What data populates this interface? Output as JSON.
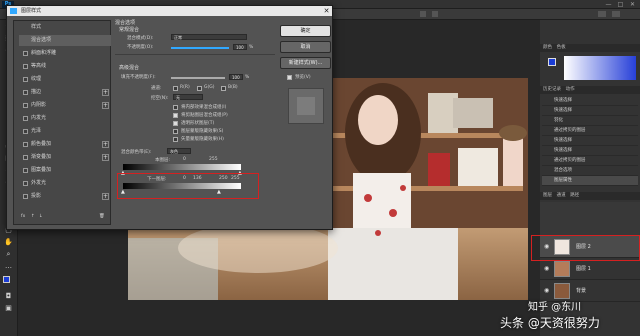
{
  "app": {
    "logo": "Ps",
    "win_controls": [
      "—",
      "□",
      "✕"
    ]
  },
  "colors": {
    "accent": "#31a8ff",
    "highlight_red": "#d52121",
    "dialog_bg": "#535353"
  },
  "dialog": {
    "title": "图层样式",
    "sidebar": [
      {
        "label": "样式",
        "checkbox": false,
        "plus": false
      },
      {
        "label": "混合选项",
        "checkbox": false,
        "plus": false
      },
      {
        "label": "斜面和浮雕",
        "checkbox": true,
        "plus": false
      },
      {
        "label": "等高线",
        "checkbox": true,
        "plus": false
      },
      {
        "label": "纹理",
        "checkbox": true,
        "plus": false
      },
      {
        "label": "描边",
        "checkbox": true,
        "plus": true
      },
      {
        "label": "内阴影",
        "checkbox": true,
        "plus": true
      },
      {
        "label": "内发光",
        "checkbox": true,
        "plus": false
      },
      {
        "label": "光泽",
        "checkbox": true,
        "plus": false
      },
      {
        "label": "颜色叠加",
        "checkbox": true,
        "plus": true
      },
      {
        "label": "渐变叠加",
        "checkbox": true,
        "plus": true
      },
      {
        "label": "图案叠加",
        "checkbox": true,
        "plus": false
      },
      {
        "label": "外发光",
        "checkbox": true,
        "plus": false
      },
      {
        "label": "投影",
        "checkbox": true,
        "plus": true
      }
    ],
    "sidebar_footer": [
      "fx",
      "↑",
      "↓",
      "🗑"
    ],
    "blend_options": {
      "section_title": "混合选项",
      "general_title": "常规混合",
      "blend_mode_label": "混合模式(D):",
      "blend_mode_value": "正常",
      "opacity_label": "不透明度(O):",
      "opacity_value": "100",
      "opacity_unit": "%",
      "opacity_fraction": 1.0,
      "advanced_title": "高级混合",
      "fill_opacity_label": "填充不透明度(F):",
      "fill_opacity_value": "100",
      "fill_opacity_unit": "%",
      "fill_opacity_fraction": 1.0,
      "channels_label": "通道:",
      "channels": [
        "R(R)",
        "G(G)",
        "B(B)"
      ],
      "knockout_label": "挖空(N):",
      "knockout_value": "无",
      "options": [
        "将内部效果混合成组(I)",
        "将剪贴图层混合成组(P)",
        "透明形状图层(T)",
        "图层蒙版隐藏效果(S)",
        "矢量蒙版隐藏效果(H)"
      ],
      "options_checked": [
        false,
        true,
        true,
        false,
        false
      ],
      "blend_if_label": "混合颜色带(E):",
      "blend_if_value": "灰色",
      "this_layer_label": "本图层:",
      "this_layer_min": "0",
      "this_layer_max": "255",
      "underlying_label": "下一图层:",
      "underlying_min": "0",
      "underlying_mid1": "136",
      "underlying_mid2": "250",
      "underlying_max": "255"
    },
    "buttons": {
      "ok": "确定",
      "cancel": "取消",
      "new_style": "新建样式(W)...",
      "preview_label": "预览(V)"
    }
  },
  "right_panel": {
    "tabs_top": [
      "颜色",
      "色板"
    ],
    "history_tabs": [
      "历史记录",
      "动作"
    ],
    "history_items": [
      "快速选择",
      "快速选择",
      "羽化",
      "通过拷贝的图层",
      "快速选择",
      "快速选择",
      "通过拷贝的图层",
      "混合选项",
      "图层属性",
      "混合选项"
    ],
    "layer_tabs": [
      "图层",
      "通道",
      "路径"
    ],
    "layers": [
      {
        "name": "图层 2",
        "selected": true
      },
      {
        "name": "图层 1",
        "selected": false
      },
      {
        "name": "背景",
        "selected": false
      }
    ]
  },
  "watermark": {
    "text": "头条 @天资很努力",
    "text2": "知乎 @东川"
  }
}
